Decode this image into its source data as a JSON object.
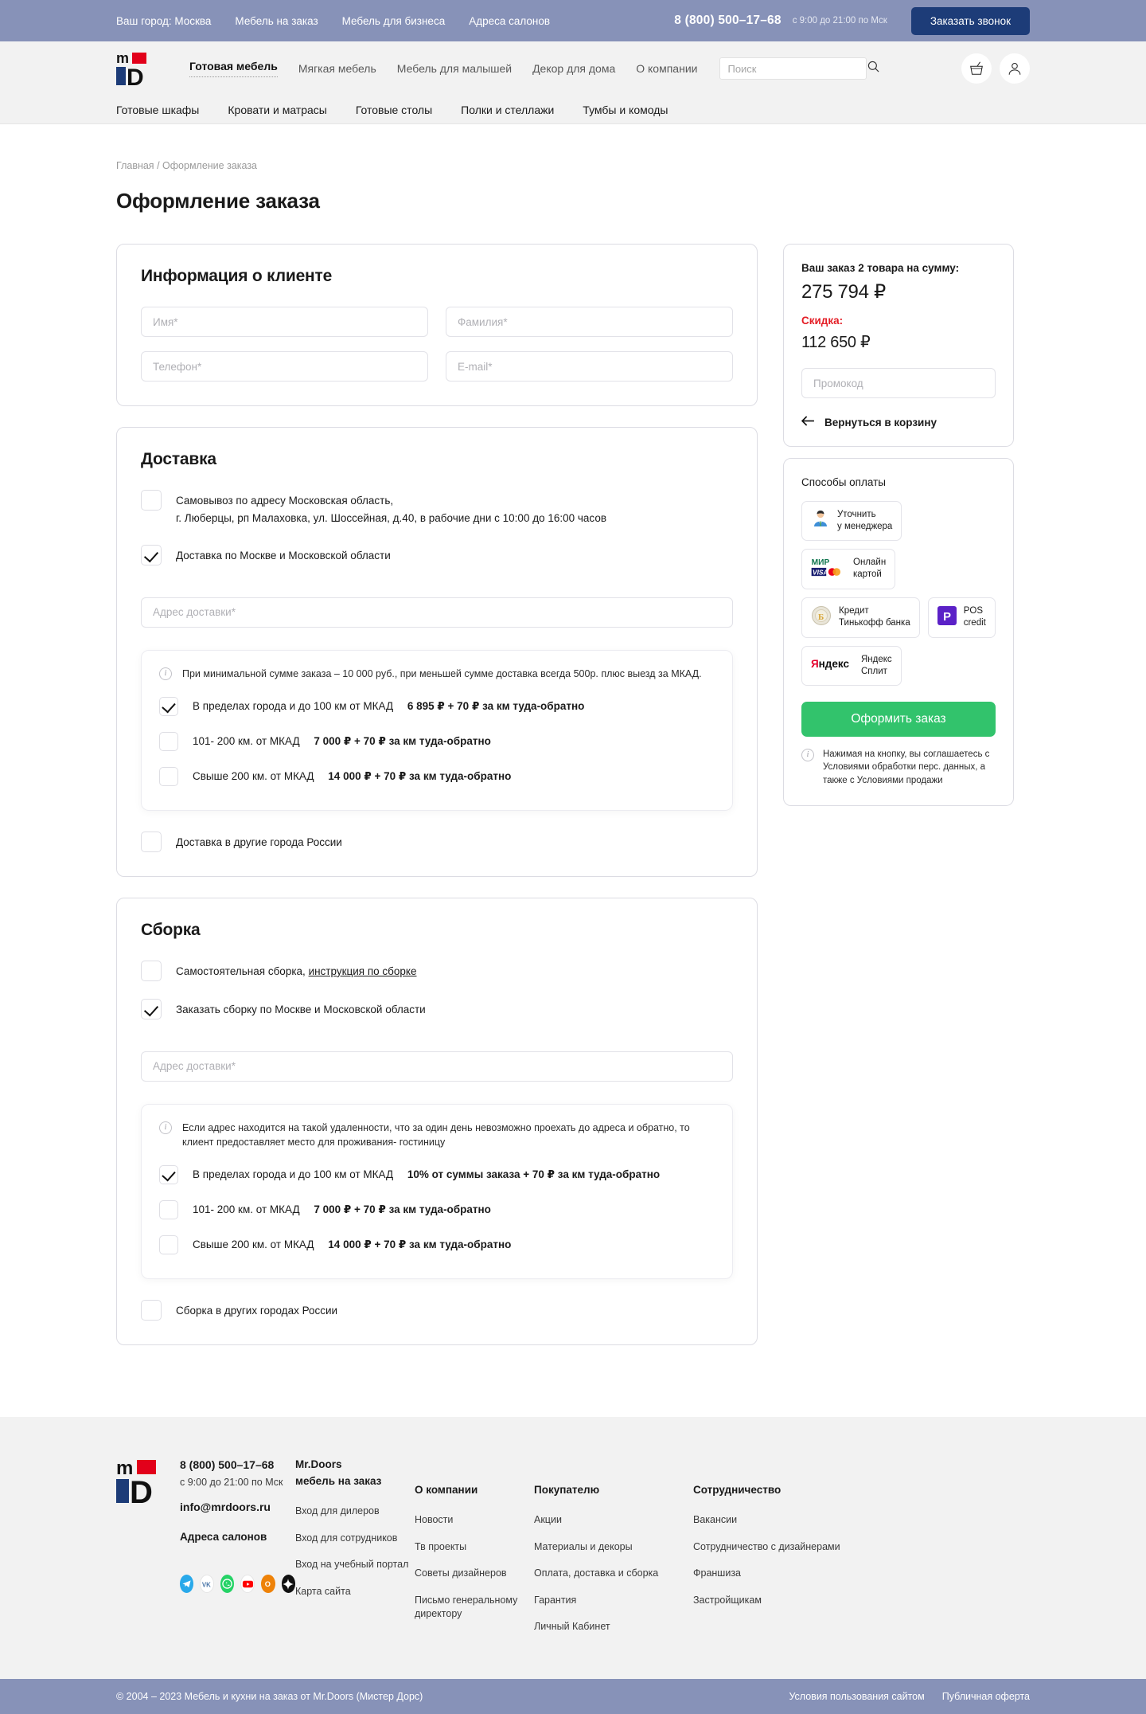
{
  "topbar": {
    "city_label": "Ваш город: Москва",
    "links": [
      "Мебель на заказ",
      "Мебель для бизнеса",
      "Адреса салонов"
    ],
    "phone": "8 (800) 500–17–68",
    "hours": "с 9:00 до 21:00 по Мск",
    "callback_button": "Заказать звонок",
    "background": "#8792b8",
    "callback_color": "#1d3c78"
  },
  "header": {
    "nav": [
      {
        "label": "Готовая мебель",
        "active": true
      },
      {
        "label": "Мягкая мебель",
        "active": false
      },
      {
        "label": "Мебель для малышей",
        "active": false
      },
      {
        "label": "Декор для дома",
        "active": false
      },
      {
        "label": "О компании",
        "active": false
      }
    ],
    "search_placeholder": "Поиск",
    "search_value": ""
  },
  "subnav": [
    "Готовые шкафы",
    "Кровати и матрасы",
    "Готовые столы",
    "Полки и стеллажи",
    "Тумбы и комоды"
  ],
  "breadcrumb": {
    "home": "Главная",
    "sep": "/",
    "current": "Оформление заказа"
  },
  "page_title": "Оформление заказа",
  "client": {
    "title": "Информация о клиенте",
    "fields": [
      {
        "placeholder": "Имя*",
        "value": ""
      },
      {
        "placeholder": "Фамилия*",
        "value": ""
      },
      {
        "placeholder": "Телефон*",
        "value": ""
      },
      {
        "placeholder": "E-mail*",
        "value": ""
      }
    ]
  },
  "delivery": {
    "title": "Доставка",
    "pickup": {
      "checked": false,
      "line1": "Самовывоз по адресу Московская область,",
      "line2": "г. Люберцы, рп Малаховка, ул. Шоссейная, д.40, в рабочие дни с 10:00 до 16:00 часов"
    },
    "moscow": {
      "checked": true,
      "label": "Доставка по Москве и Московской области"
    },
    "address_placeholder": "Адрес доставки*",
    "address_value": "",
    "note": "При минимальной сумме заказа – 10 000 руб., при меньшей сумме доставка всегда 500р. плюс выезд за МКАД.",
    "options": [
      {
        "checked": true,
        "label": "В пределах города и до 100 км от МКАД",
        "price": "6 895 ₽ + 70 ₽ за км туда-обратно"
      },
      {
        "checked": false,
        "label": "101- 200 км. от МКАД",
        "price": "7 000 ₽ + 70 ₽ за км туда-обратно"
      },
      {
        "checked": false,
        "label": "Свыше 200 км. от МКАД",
        "price": "14 000 ₽ + 70 ₽ за км туда-обратно"
      }
    ],
    "other_cities": {
      "checked": false,
      "label": "Доставка в другие города России"
    }
  },
  "assembly": {
    "title": "Сборка",
    "self": {
      "checked": false,
      "label": "Самостоятельная сборка,",
      "link": "инструкция по сборке"
    },
    "order": {
      "checked": true,
      "label": "Заказать сборку по Москве и Московской области"
    },
    "address_placeholder": "Адрес доставки*",
    "address_value": "",
    "note": "Если адрес находится на такой удаленности, что за один день невозможно проехать до адреса и обратно, то клиент предоставляет место для проживания- гостиницу",
    "options": [
      {
        "checked": true,
        "label": "В пределах города и до 100 км от МКАД",
        "price": "10% от суммы заказа + 70 ₽ за км туда-обратно"
      },
      {
        "checked": false,
        "label": "101- 200 км. от МКАД",
        "price": "7 000 ₽ + 70 ₽ за км туда-обратно"
      },
      {
        "checked": false,
        "label": "Свыше 200 км. от МКАД",
        "price": "14 000 ₽ + 70 ₽ за км туда-обратно"
      }
    ],
    "other_cities": {
      "checked": false,
      "label": "Сборка в других городах России"
    }
  },
  "order_summary": {
    "label": "Ваш заказ 2 товара на сумму:",
    "total": "275 794 ₽",
    "discount_label": "Скидка:",
    "discount_value": "112 650 ₽",
    "discount_color": "#e41e26",
    "promo_placeholder": "Промокод",
    "promo_value": "",
    "back_to_cart": "Вернуться в корзину"
  },
  "payment": {
    "title": "Способы оплаты",
    "methods": [
      {
        "label": "Уточнить\nу менеджера",
        "icon": "manager-icon"
      },
      {
        "label": "Онлайн\nкартой",
        "icon": "cards-icon"
      },
      {
        "label": "Кредит\nТинькофф банка",
        "icon": "tinkoff-icon"
      },
      {
        "label": "POS\ncredit",
        "icon": "pos-credit-icon"
      },
      {
        "label": "Яндекс\nСплит",
        "icon": "yandex-split-icon"
      }
    ],
    "submit_label": "Оформить заказ",
    "submit_color": "#32c36c",
    "agreement": "Нажимая на кнопку, вы соглашаетесь с Условиями обработки перс. данных, а также с Условиями продажи"
  },
  "footer": {
    "phone": "8 (800) 500–17–68",
    "hours": "с 9:00 до 21:00 по Мск",
    "email": "info@mrdoors.ru",
    "salons": "Адреса салонов",
    "socials": [
      "telegram-icon",
      "vk-icon",
      "whatsapp-icon",
      "youtube-icon",
      "odnoklassniki-icon",
      "zen-icon"
    ],
    "columns": [
      {
        "head": "Mr.Doors",
        "head2": "мебель на заказ",
        "links": [
          "Вход для дилеров",
          "Вход для сотрудников",
          "Вход на учебный портал",
          "Карта сайта"
        ]
      },
      {
        "head2": "О компании",
        "links": [
          "Новости",
          "Тв проекты",
          "Советы дизайнеров",
          "Письмо генеральному директору"
        ]
      },
      {
        "head2": "Покупателю",
        "links": [
          "Акции",
          "Материалы и декоры",
          "Оплата, доставка и сборка",
          "Гарантия",
          "Личный Кабинет"
        ]
      },
      {
        "head2": "Сотрудничество",
        "links": [
          "Вакансии",
          "Сотрудничество с дизайнерами",
          "Франшиза",
          "Застройщикам"
        ]
      }
    ]
  },
  "copyright": {
    "text": "© 2004 – 2023 Мебель и кухни на заказ от Mr.Doors (Мистер Дорс)",
    "links": [
      "Условия пользования сайтом",
      "Публичная оферта"
    ]
  }
}
